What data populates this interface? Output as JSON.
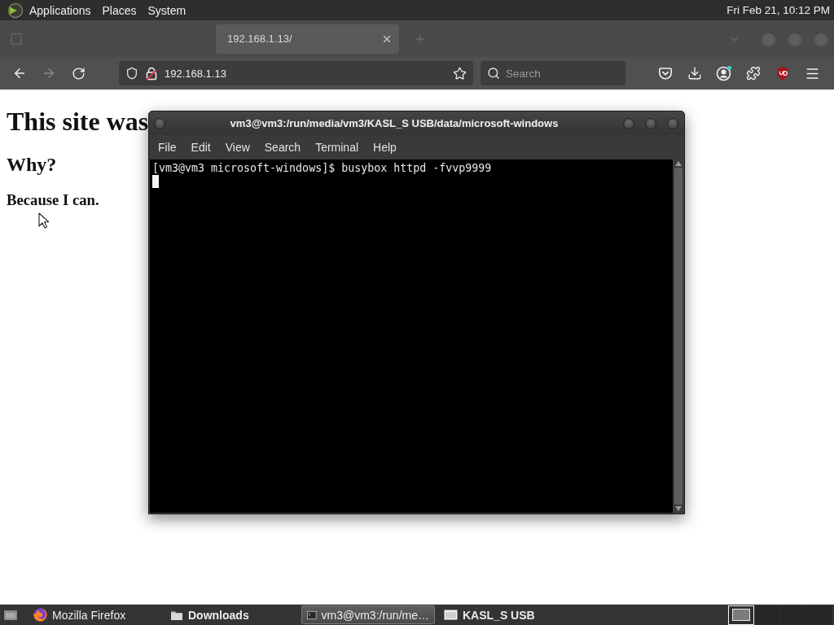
{
  "top_panel": {
    "menus": [
      "Applications",
      "Places",
      "System"
    ],
    "clock": "Fri Feb 21, 10:12 PM"
  },
  "browser": {
    "tabs": [
      {
        "selected": false
      },
      {
        "label": "192.168.1.13/",
        "selected": true
      }
    ],
    "nav_buttons": [
      {
        "kind": "back",
        "disabled": false
      },
      {
        "kind": "forward",
        "disabled": true
      },
      {
        "kind": "reload",
        "disabled": false
      }
    ],
    "address_bar": {
      "value": "192.168.1.13",
      "secure": false
    },
    "search": {
      "placeholder": "Search"
    },
    "toolbar_icons": [
      {
        "kind": "pocket"
      },
      {
        "kind": "downloads"
      },
      {
        "kind": "account"
      },
      {
        "kind": "extensions"
      },
      {
        "kind": "ublock"
      },
      {
        "kind": "menu"
      }
    ]
  },
  "page": {
    "heading": "This site was",
    "subheading": "Why?",
    "text": "Because I can."
  },
  "terminal": {
    "title": "vm3@vm3:/run/media/vm3/KASL_S USB/data/microsoft-windows",
    "menus": [
      "File",
      "Edit",
      "View",
      "Search",
      "Terminal",
      "Help"
    ],
    "lines": [
      "[vm3@vm3 microsoft-windows]$ busybox httpd -fvvp9999"
    ]
  },
  "taskbar": {
    "tasks": [
      {
        "kind": "browser",
        "label": "Mozilla Firefox",
        "selected": false,
        "emphasized": false
      },
      {
        "kind": "folder",
        "label": "Downloads",
        "selected": false,
        "emphasized": true
      },
      {
        "kind": "terminal",
        "label": "vm3@vm3:/run/me…",
        "selected": true,
        "emphasized": false
      },
      {
        "kind": "window",
        "label": "KASL_S USB",
        "selected": false,
        "emphasized": true
      }
    ],
    "workspaces": [
      {
        "selected": true
      },
      {
        "selected": false
      },
      {
        "selected": false
      },
      {
        "selected": false
      }
    ]
  }
}
